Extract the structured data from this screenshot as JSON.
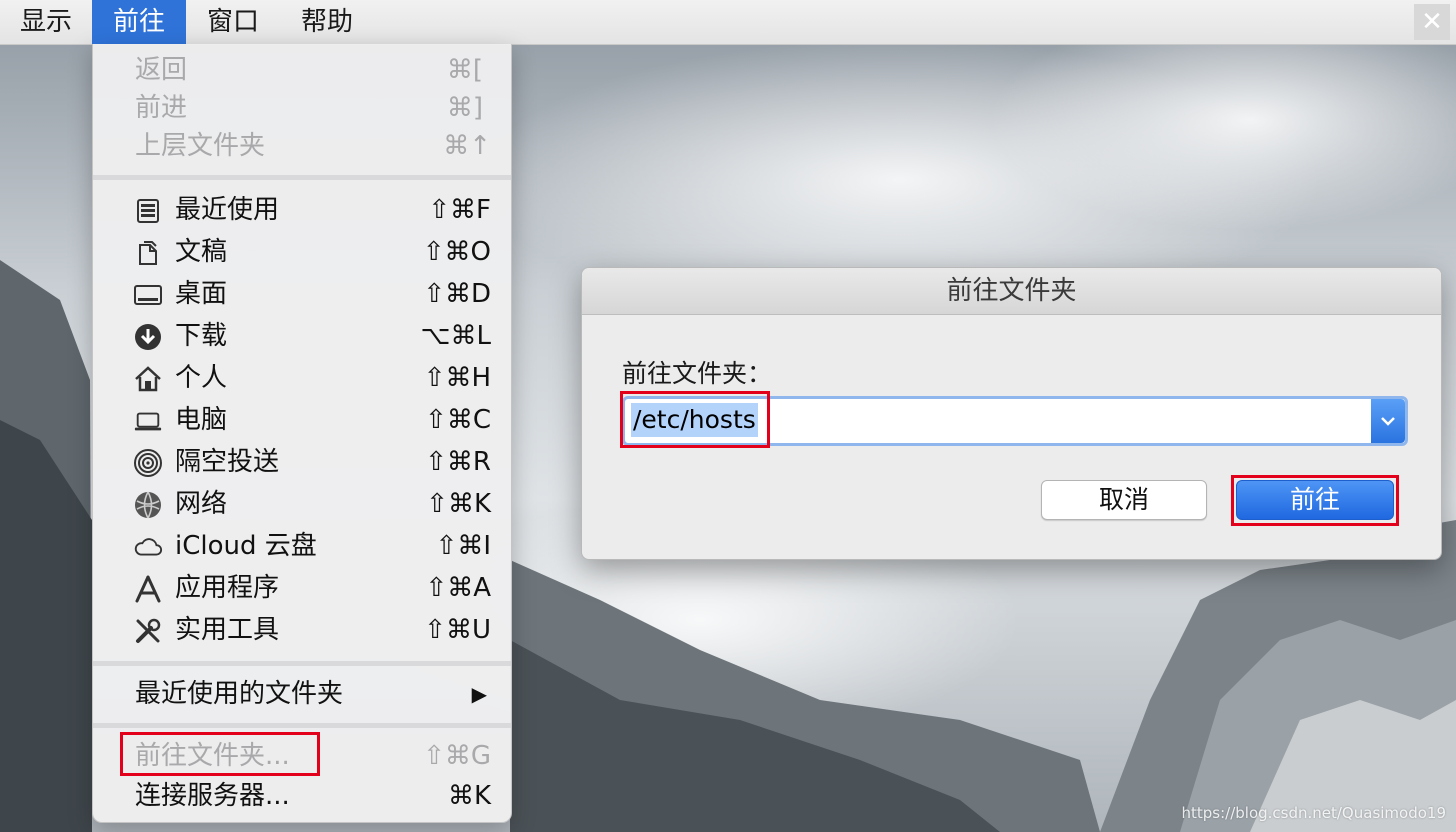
{
  "menubar": {
    "items": [
      "显示",
      "前往",
      "窗口",
      "帮助"
    ],
    "active": "前往",
    "close_glyph": "✕"
  },
  "menu": {
    "nav_items": [
      {
        "label": "返回",
        "shortcut": "⌘[",
        "enabled": false
      },
      {
        "label": "前进",
        "shortcut": "⌘]",
        "enabled": false
      },
      {
        "label": "上层文件夹",
        "shortcut": "⌘↑",
        "enabled": false
      }
    ],
    "places": [
      {
        "icon": "recents-icon",
        "label": "最近使用",
        "shortcut": "⇧⌘F"
      },
      {
        "icon": "documents-icon",
        "label": "文稿",
        "shortcut": "⇧⌘O"
      },
      {
        "icon": "desktop-icon",
        "label": "桌面",
        "shortcut": "⇧⌘D"
      },
      {
        "icon": "downloads-icon",
        "label": "下载",
        "shortcut": "⌥⌘L"
      },
      {
        "icon": "home-icon",
        "label": "个人",
        "shortcut": "⇧⌘H"
      },
      {
        "icon": "computer-icon",
        "label": "电脑",
        "shortcut": "⇧⌘C"
      },
      {
        "icon": "airdrop-icon",
        "label": "隔空投送",
        "shortcut": "⇧⌘R"
      },
      {
        "icon": "network-icon",
        "label": "网络",
        "shortcut": "⇧⌘K"
      },
      {
        "icon": "icloud-icon",
        "label": "iCloud 云盘",
        "shortcut": "⇧⌘I"
      },
      {
        "icon": "applications-icon",
        "label": "应用程序",
        "shortcut": "⇧⌘A"
      },
      {
        "icon": "utilities-icon",
        "label": "实用工具",
        "shortcut": "⇧⌘U"
      }
    ],
    "recent_folders": {
      "label": "最近使用的文件夹",
      "arrow": "▶"
    },
    "goto_folder": {
      "label": "前往文件夹...",
      "shortcut": "⇧⌘G",
      "enabled": false
    },
    "connect_server": {
      "label": "连接服务器...",
      "shortcut": "⌘K"
    }
  },
  "dialog": {
    "title": "前往文件夹",
    "prompt": "前往文件夹：",
    "path_value": "/etc/hosts",
    "cancel_label": "取消",
    "go_label": "前往"
  },
  "watermark": "https://blog.csdn.net/Quasimodo19",
  "colors": {
    "accent": "#2f73d9",
    "annotation_red": "#e2001a"
  }
}
